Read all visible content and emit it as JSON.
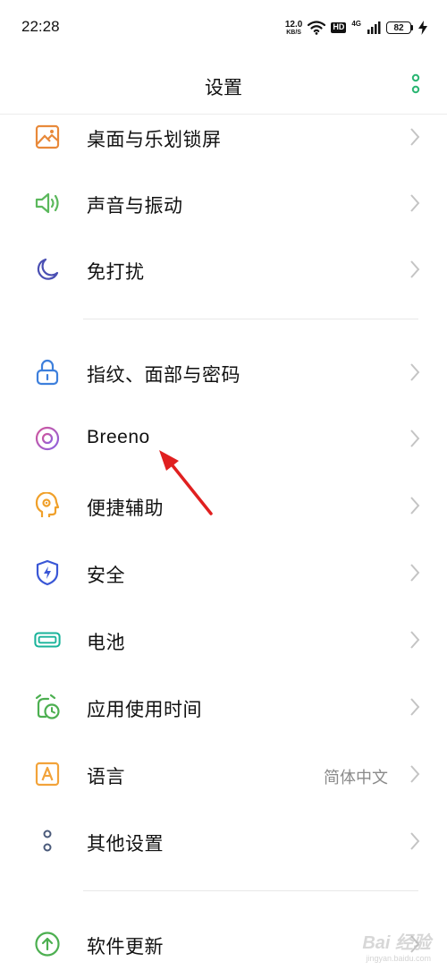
{
  "status_bar": {
    "time": "22:28",
    "net_speed": "12.0",
    "net_unit": "KB/S",
    "hd_label": "HD",
    "network_label": "4G",
    "battery_level": "82"
  },
  "header": {
    "title": "设置"
  },
  "items": [
    {
      "label": "桌面与乐划锁屏",
      "icon": "wallpaper-icon"
    },
    {
      "label": "声音与振动",
      "icon": "speaker-icon"
    },
    {
      "label": "免打扰",
      "icon": "moon-icon"
    },
    {
      "label": "指纹、面部与密码",
      "icon": "lock-icon"
    },
    {
      "label": "Breeno",
      "icon": "breeno-icon"
    },
    {
      "label": "便捷辅助",
      "icon": "head-gear-icon"
    },
    {
      "label": "安全",
      "icon": "shield-icon"
    },
    {
      "label": "电池",
      "icon": "battery-icon"
    },
    {
      "label": "应用使用时间",
      "icon": "alarm-clock-icon"
    },
    {
      "label": "语言",
      "value": "简体中文",
      "icon": "language-icon"
    },
    {
      "label": "其他设置",
      "icon": "more-settings-icon"
    },
    {
      "label": "软件更新",
      "icon": "update-icon"
    }
  ],
  "colors": {
    "accent_green": "#2bb673",
    "wallpaper_orange": "#e8893a",
    "sound_green": "#5bb85c",
    "moon_indigo": "#4a4fb3",
    "lock_blue": "#3d7fdc",
    "breeno_purple": "#b05bd6",
    "accessibility_orange": "#f0a02a",
    "shield_blue": "#3a57d6",
    "battery_teal": "#19b39a",
    "clock_green": "#4caf50",
    "language_orange": "#f2a33a",
    "annotation_red": "#e02020"
  },
  "watermark": {
    "main": "Bai 经验",
    "url": "jingyan.baidu.com"
  }
}
